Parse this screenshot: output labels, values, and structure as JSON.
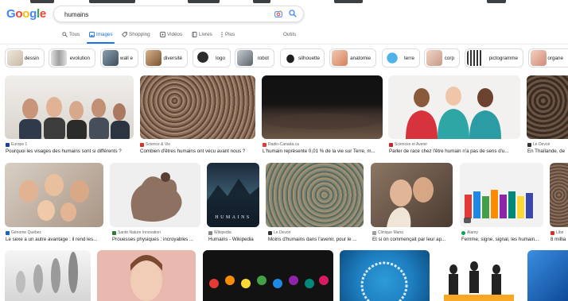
{
  "search": {
    "logo_letters": [
      "G",
      "o",
      "o",
      "g",
      "l",
      "e"
    ],
    "query": "humains",
    "camera_icon": "camera-lens-icon",
    "search_icon": "magnifier-icon"
  },
  "tabs": [
    {
      "label": "Tous",
      "icon": "search-icon",
      "active": false
    },
    {
      "label": "Images",
      "icon": "image-icon",
      "active": true
    },
    {
      "label": "Shopping",
      "icon": "tag-icon",
      "active": false
    },
    {
      "label": "Vidéos",
      "icon": "play-icon",
      "active": false
    },
    {
      "label": "Livres",
      "icon": "book-icon",
      "active": false
    },
    {
      "label": "Plus",
      "icon": "more-vert-icon",
      "active": false
    },
    {
      "label": "Outils",
      "icon": "",
      "active": false
    }
  ],
  "chips": [
    {
      "label": "dessin",
      "thumb_color": "#d8cfc4"
    },
    {
      "label": "evolution",
      "thumb_color": "#bdbdbd"
    },
    {
      "label": "wall e",
      "thumb_color": "#6b7d8c"
    },
    {
      "label": "diversité",
      "thumb_color": "#b9906a"
    },
    {
      "label": "logo",
      "thumb_color": "#2b2b2b"
    },
    {
      "label": "robot",
      "thumb_color": "#9aa3ab"
    },
    {
      "label": "silhouette",
      "thumb_color": "#1f1f1f"
    },
    {
      "label": "anatomie",
      "thumb_color": "#e6a98a"
    },
    {
      "label": "terre",
      "thumb_color": "#2d9bd8"
    },
    {
      "label": "corp",
      "thumb_color": "#e0b8a8"
    },
    {
      "label": "pictogramme",
      "thumb_color": "#333333"
    },
    {
      "label": "organe",
      "thumb_color": "#e8b5a2"
    }
  ],
  "results": {
    "row1": [
      {
        "source": "Europe 1",
        "fav_color": "#1a3ea8",
        "title": "Pourquoi les visages des humains sont si différents ?",
        "bg": "#e9e6e2"
      },
      {
        "source": "Science & Vie",
        "fav_color": "#d93025",
        "title": "Combien d'êtres humains ont vécu avant nous ?",
        "bg": "#7a5a4a"
      },
      {
        "source": "Radio-Canada.ca",
        "fav_color": "#e53935",
        "title": "L'humain représente 0,01 % de la vie sur Terre, m...",
        "bg": "#2b2520"
      },
      {
        "source": "Sciences et Avenir",
        "fav_color": "#c62828",
        "title": "Parler de race chez l'être humain n'a pas de sens d'u...",
        "bg": "#f3f1ef"
      },
      {
        "source": "Le Devoir",
        "fav_color": "#333333",
        "title": "En Thaïlande, de",
        "bg": "#5a4636"
      }
    ],
    "row2": [
      {
        "source": "Génome Québec",
        "fav_color": "#1565c0",
        "title": "Le sexe a un autre avantage : il rend les...",
        "bg": "#cfc6bb"
      },
      {
        "source": "Santé Nature Innovation",
        "fav_color": "#2e7d32",
        "title": "Prouesses physiques : incroyables ...",
        "bg": "#eeeeee"
      },
      {
        "source": "Wikipedia",
        "fav_color": "#888888",
        "title": "Humains - Wikipedia",
        "bg": "#27384a",
        "poster_text": "HUMAINS"
      },
      {
        "source": "Le Devoir",
        "fav_color": "#333333",
        "title": "Moins d'humains dans l'avenir, pour le ...",
        "bg": "#6d7a6a"
      },
      {
        "source": "Clinique Mana",
        "fav_color": "#9e9e9e",
        "title": "Et si on commençait par leur ap...",
        "bg": "#6a5748"
      },
      {
        "source": "Alamy",
        "fav_color": "#00a651",
        "title": "Femme, signe, signal, les humain...",
        "bg": "#f2f2f2"
      },
      {
        "source": "Libé",
        "fav_color": "#d32f2f",
        "title": "8 millia",
        "bg": "#8a6e5a"
      }
    ],
    "row3": [
      {
        "bg": "#d6d6d6"
      },
      {
        "bg": "#e9b9b0"
      },
      {
        "bg": "#121212"
      },
      {
        "bg": "#1e7fc1"
      },
      {
        "bg": "#ffffff"
      },
      {
        "bg": "#1b6bb8"
      }
    ]
  }
}
